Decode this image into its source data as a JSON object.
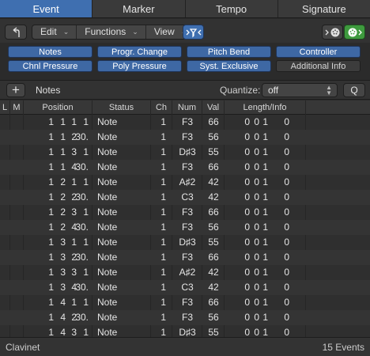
{
  "tabs": [
    {
      "label": "Event"
    },
    {
      "label": "Marker"
    },
    {
      "label": "Tempo"
    },
    {
      "label": "Signature"
    }
  ],
  "toolbar": {
    "back_icon": "back-arrow-icon",
    "edit_label": "Edit",
    "functions_label": "Functions",
    "view_label": "View",
    "filter_icon": "midi-filter-icon",
    "midi_out_icon": "midi-out-icon",
    "midi_in_icon": "midi-in-icon"
  },
  "filters": [
    {
      "label": "Notes",
      "active": true
    },
    {
      "label": "Progr. Change",
      "active": true
    },
    {
      "label": "Pitch Bend",
      "active": true
    },
    {
      "label": "Controller",
      "active": true
    },
    {
      "label": "Chnl Pressure",
      "active": true
    },
    {
      "label": "Poly Pressure",
      "active": true
    },
    {
      "label": "Syst. Exclusive",
      "active": true
    },
    {
      "label": "Additional Info",
      "active": false
    }
  ],
  "region": {
    "add_label": "+",
    "name": "Notes",
    "quantize_label": "Quantize:",
    "quantize_value": "off",
    "q_label": "Q"
  },
  "table": {
    "headers": {
      "l": "L",
      "m": "M",
      "position": "Position",
      "status": "Status",
      "ch": "Ch",
      "num": "Num",
      "val": "Val",
      "length": "Length/Info"
    },
    "rows": [
      {
        "pos": [
          "1",
          "1",
          "1",
          "1"
        ],
        "status": "Note",
        "ch": "1",
        "num": "F3",
        "val": "66",
        "len": [
          "0",
          "0",
          "1",
          "0"
        ]
      },
      {
        "pos": [
          "1",
          "1",
          "2",
          "30."
        ],
        "status": "Note",
        "ch": "1",
        "num": "F3",
        "val": "56",
        "len": [
          "0",
          "0",
          "1",
          "0"
        ]
      },
      {
        "pos": [
          "1",
          "1",
          "3",
          "1"
        ],
        "status": "Note",
        "ch": "1",
        "num": "D♯3",
        "val": "55",
        "len": [
          "0",
          "0",
          "1",
          "0"
        ]
      },
      {
        "pos": [
          "1",
          "1",
          "4",
          "30."
        ],
        "status": "Note",
        "ch": "1",
        "num": "F3",
        "val": "66",
        "len": [
          "0",
          "0",
          "1",
          "0"
        ]
      },
      {
        "pos": [
          "1",
          "2",
          "1",
          "1"
        ],
        "status": "Note",
        "ch": "1",
        "num": "A♯2",
        "val": "42",
        "len": [
          "0",
          "0",
          "1",
          "0"
        ]
      },
      {
        "pos": [
          "1",
          "2",
          "2",
          "30."
        ],
        "status": "Note",
        "ch": "1",
        "num": "C3",
        "val": "42",
        "len": [
          "0",
          "0",
          "1",
          "0"
        ]
      },
      {
        "pos": [
          "1",
          "2",
          "3",
          "1"
        ],
        "status": "Note",
        "ch": "1",
        "num": "F3",
        "val": "66",
        "len": [
          "0",
          "0",
          "1",
          "0"
        ]
      },
      {
        "pos": [
          "1",
          "2",
          "4",
          "30."
        ],
        "status": "Note",
        "ch": "1",
        "num": "F3",
        "val": "56",
        "len": [
          "0",
          "0",
          "1",
          "0"
        ]
      },
      {
        "pos": [
          "1",
          "3",
          "1",
          "1"
        ],
        "status": "Note",
        "ch": "1",
        "num": "D♯3",
        "val": "55",
        "len": [
          "0",
          "0",
          "1",
          "0"
        ]
      },
      {
        "pos": [
          "1",
          "3",
          "2",
          "30."
        ],
        "status": "Note",
        "ch": "1",
        "num": "F3",
        "val": "66",
        "len": [
          "0",
          "0",
          "1",
          "0"
        ]
      },
      {
        "pos": [
          "1",
          "3",
          "3",
          "1"
        ],
        "status": "Note",
        "ch": "1",
        "num": "A♯2",
        "val": "42",
        "len": [
          "0",
          "0",
          "1",
          "0"
        ]
      },
      {
        "pos": [
          "1",
          "3",
          "4",
          "30."
        ],
        "status": "Note",
        "ch": "1",
        "num": "C3",
        "val": "42",
        "len": [
          "0",
          "0",
          "1",
          "0"
        ]
      },
      {
        "pos": [
          "1",
          "4",
          "1",
          "1"
        ],
        "status": "Note",
        "ch": "1",
        "num": "F3",
        "val": "66",
        "len": [
          "0",
          "0",
          "1",
          "0"
        ]
      },
      {
        "pos": [
          "1",
          "4",
          "2",
          "30."
        ],
        "status": "Note",
        "ch": "1",
        "num": "F3",
        "val": "56",
        "len": [
          "0",
          "0",
          "1",
          "0"
        ]
      },
      {
        "pos": [
          "1",
          "4",
          "3",
          "1"
        ],
        "status": "Note",
        "ch": "1",
        "num": "D♯3",
        "val": "55",
        "len": [
          "0",
          "0",
          "1",
          "0"
        ]
      }
    ]
  },
  "footer": {
    "track_name": "Clavinet",
    "event_count": "15 Events"
  },
  "colors": {
    "accent": "#3f6fb0",
    "filter_active": "#3e68a4",
    "midi_in_green": "#3e9a3e"
  }
}
